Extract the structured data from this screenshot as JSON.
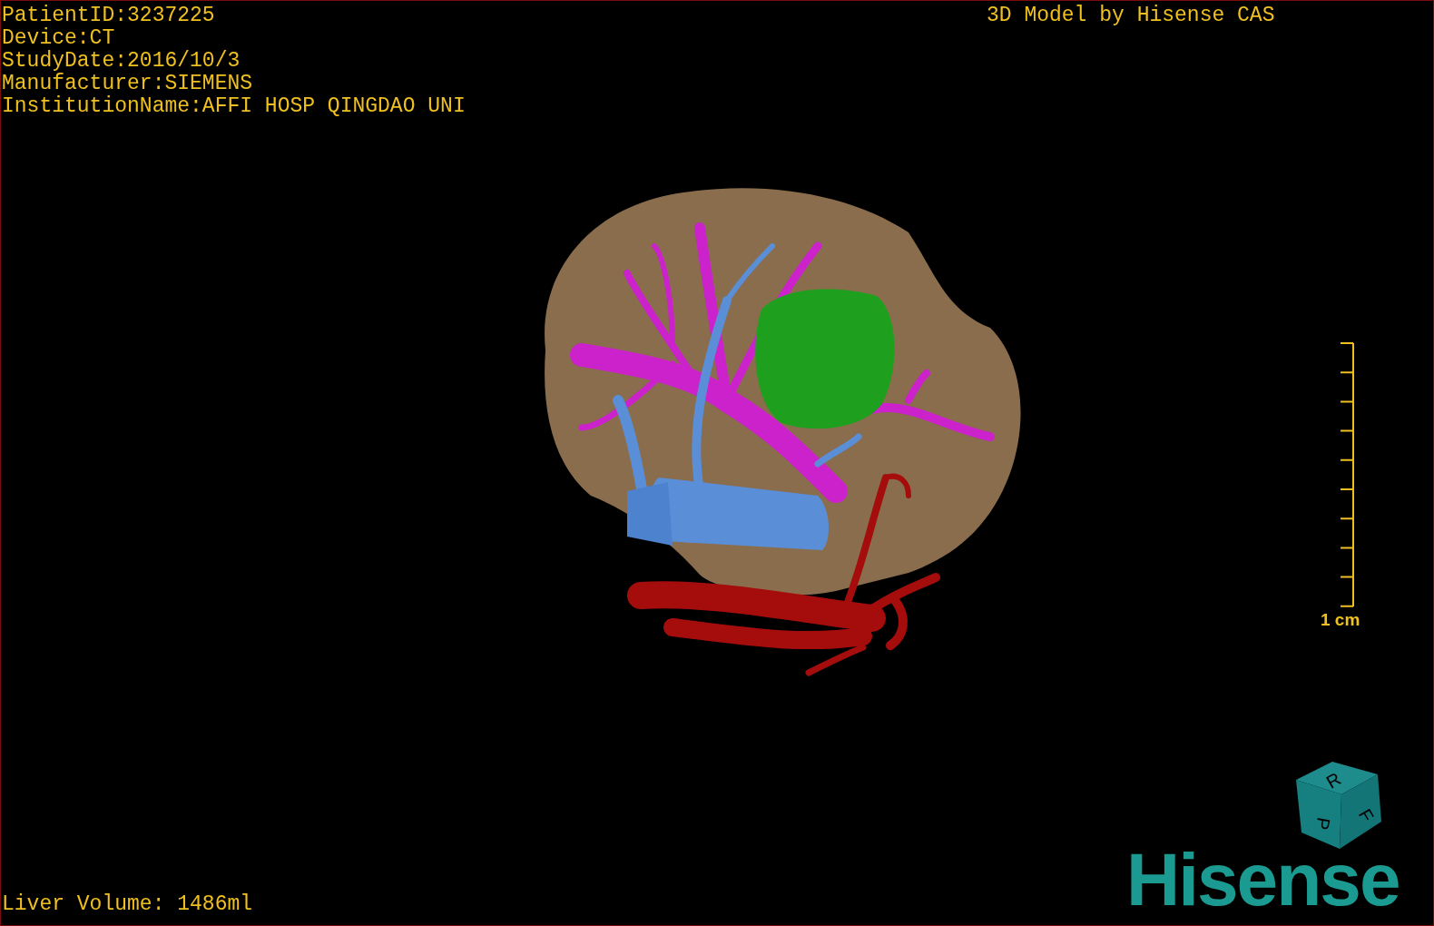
{
  "patient_info": [
    "PatientID:3237225",
    "Device:CT",
    "StudyDate:2016/10/3",
    "Manufacturer:SIEMENS",
    "InstitutionName:AFFI HOSP QINGDAO UNI"
  ],
  "title": "3D Model by Hisense CAS",
  "scale_bar": {
    "label": "1 cm"
  },
  "orientation_cube": {
    "labels": [
      "R",
      "F",
      "P"
    ]
  },
  "logo": "Hisense",
  "footer": "Liver Volume: 1486ml"
}
